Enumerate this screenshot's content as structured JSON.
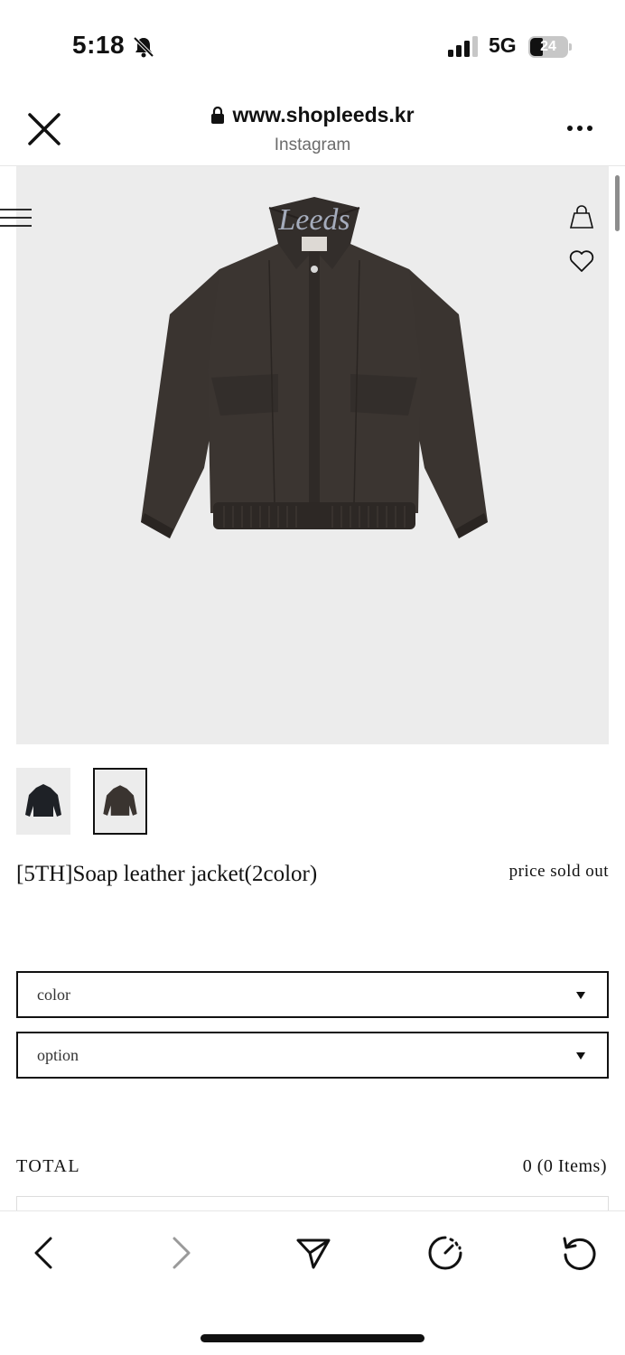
{
  "status_bar": {
    "time": "5:18",
    "network": "5G",
    "battery": "24"
  },
  "browser": {
    "url": "www.shopleeds.kr",
    "source": "Instagram"
  },
  "product": {
    "brand_watermark": "Leeds",
    "name": "[5TH]Soap leather jacket(2color)",
    "price": "price sold out",
    "selects": [
      {
        "label": "color"
      },
      {
        "label": "option"
      }
    ],
    "total_label": "TOTAL",
    "total_value": "0 (0 Items)"
  },
  "colors": {
    "hero_bg": "#ececec",
    "jacket": "#3a3430",
    "text": "#111111"
  },
  "icons": {
    "close": "close-icon",
    "lock": "lock-icon",
    "more": "more-icon",
    "menu": "menu-icon",
    "bag": "shopping-bag-icon",
    "heart": "heart-icon",
    "back": "chevron-left-icon",
    "forward": "chevron-right-icon",
    "share": "send-icon",
    "speed": "speedometer-icon",
    "reload": "reload-icon"
  }
}
